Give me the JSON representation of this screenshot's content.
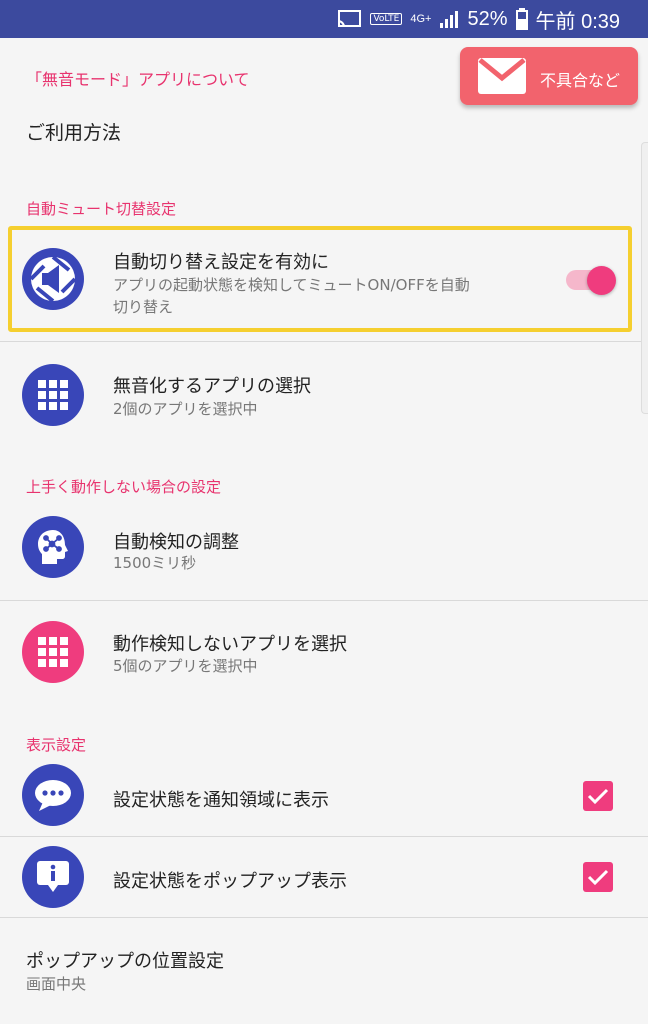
{
  "status_bar": {
    "volte": "VoLTE",
    "network": "4G+",
    "battery": "52%",
    "time": "午前 0:39"
  },
  "header": {
    "about_link": "「無音モード」アプリについて",
    "report_button": "不具合など",
    "usage": "ご利用方法"
  },
  "sections": {
    "auto_mute": "自動ミュート切替設定",
    "troubleshoot": "上手く動作しない場合の設定",
    "display": "表示設定"
  },
  "items": {
    "auto_switch": {
      "title": "自動切り替え設定を有効に",
      "subtitle_line1": "アプリの起動状態を検知してミュートON/OFFを自動",
      "subtitle_line2": "切り替え",
      "enabled": true
    },
    "mute_apps": {
      "title": "無音化するアプリの選択",
      "subtitle": "2個のアプリを選択中"
    },
    "detection": {
      "title": "自動検知の調整",
      "subtitle": "1500ミリ秒"
    },
    "exclude_apps": {
      "title": "動作検知しないアプリを選択",
      "subtitle": "5個のアプリを選択中"
    },
    "notify": {
      "title": "設定状態を通知領域に表示",
      "checked": true
    },
    "popup": {
      "title": "設定状態をポップアップ表示",
      "checked": true
    },
    "popup_position": {
      "title": "ポップアップの位置設定",
      "subtitle": "画面中央"
    }
  },
  "colors": {
    "accent": "#ef3c7e",
    "icon_blue": "#3946b8",
    "status_bar": "#3c4a9e",
    "highlight": "#f5cf2f"
  }
}
